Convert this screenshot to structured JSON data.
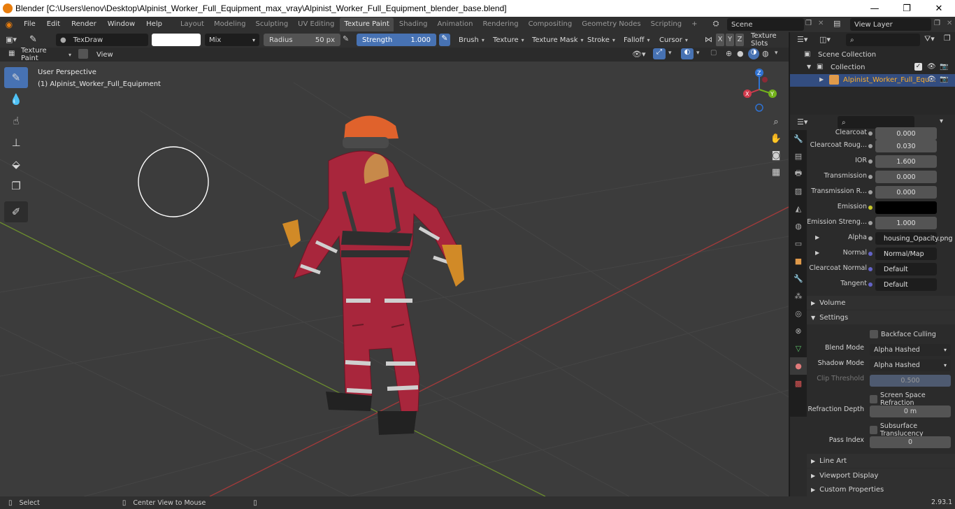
{
  "window": {
    "title": "Blender [C:\\Users\\lenov\\Desktop\\Alpinist_Worker_Full_Equipment_max_vray\\Alpinist_Worker_Full_Equipment_blender_base.blend]",
    "minimize": "—",
    "maximize": "❐",
    "close": "✕"
  },
  "menu": [
    "File",
    "Edit",
    "Render",
    "Window",
    "Help"
  ],
  "workspaces": [
    "Layout",
    "Modeling",
    "Sculpting",
    "UV Editing",
    "Texture Paint",
    "Shading",
    "Animation",
    "Rendering",
    "Compositing",
    "Geometry Nodes",
    "Scripting"
  ],
  "active_workspace": "Texture Paint",
  "add_workspace": "+",
  "scene": {
    "name": "Scene",
    "view_layer": "View Layer"
  },
  "tool_header": {
    "brush_name": "TexDraw",
    "blend": "Mix",
    "radius_label": "Radius",
    "radius_value": "50 px",
    "strength_label": "Strength",
    "strength_value": "1.000",
    "menus": [
      "Brush",
      "Texture",
      "Texture Mask",
      "Stroke",
      "Falloff",
      "Cursor"
    ],
    "axes": [
      "X",
      "Y",
      "Z"
    ],
    "texture_slots": "Texture Slots"
  },
  "viewport_header": {
    "mode": "Texture Paint",
    "view": "View"
  },
  "viewport": {
    "perspective": "User Perspective",
    "object": "(1) Alpinist_Worker_Full_Equipment",
    "gizmo": {
      "z": "Z",
      "x": "X",
      "y": "Y"
    }
  },
  "outliner": {
    "root": "Scene Collection",
    "collection": "Collection",
    "object": "Alpinist_Worker_Full_Equ..."
  },
  "properties": {
    "rows": [
      {
        "label": "Clearcoat",
        "value": "0.000",
        "type": "num",
        "dot": "#a0a0a0"
      },
      {
        "label": "Clearcoat Roug...",
        "value": "0.030",
        "type": "num",
        "dot": "#a0a0a0"
      },
      {
        "label": "IOR",
        "value": "1.600",
        "type": "num",
        "dot": "#a0a0a0"
      },
      {
        "label": "Transmission",
        "value": "0.000",
        "type": "num",
        "dot": "#a0a0a0"
      },
      {
        "label": "Transmission R...",
        "value": "0.000",
        "type": "num",
        "dot": "#a0a0a0"
      },
      {
        "label": "Emission",
        "value": "",
        "type": "color",
        "dot": "#c7c729"
      },
      {
        "label": "Emission Streng...",
        "value": "1.000",
        "type": "num",
        "dot": "#a0a0a0"
      },
      {
        "label": "Alpha",
        "value": "housing_Opacity.png",
        "type": "link",
        "dot": "#a0a0a0"
      },
      {
        "label": "Normal",
        "value": "Normal/Map",
        "type": "link",
        "dot": "#6363c7"
      },
      {
        "label": "Clearcoat Normal",
        "value": "Default",
        "type": "link",
        "dot": "#6363c7"
      },
      {
        "label": "Tangent",
        "value": "Default",
        "type": "link",
        "dot": "#6363c7"
      }
    ],
    "panels": {
      "volume": "Volume",
      "settings": "Settings",
      "line_art": "Line Art",
      "viewport_display": "Viewport Display",
      "custom_properties": "Custom Properties"
    },
    "settings": {
      "backface_culling": "Backface Culling",
      "blend_mode_label": "Blend Mode",
      "blend_mode": "Alpha Hashed",
      "shadow_mode_label": "Shadow Mode",
      "shadow_mode": "Alpha Hashed",
      "clip_threshold_label": "Clip Threshold",
      "clip_threshold": "0.500",
      "screen_space_refraction": "Screen Space Refraction",
      "refraction_depth_label": "Refraction Depth",
      "refraction_depth": "0 m",
      "subsurface_translucency": "Subsurface Translucency",
      "pass_index_label": "Pass Index",
      "pass_index": "0"
    }
  },
  "status": {
    "select": "Select",
    "center": "Center View to Mouse",
    "version": "2.93.1"
  },
  "colors": {
    "accent": "#4772b3",
    "viewport_bg": "#3c3c3c",
    "header": "#303030"
  }
}
